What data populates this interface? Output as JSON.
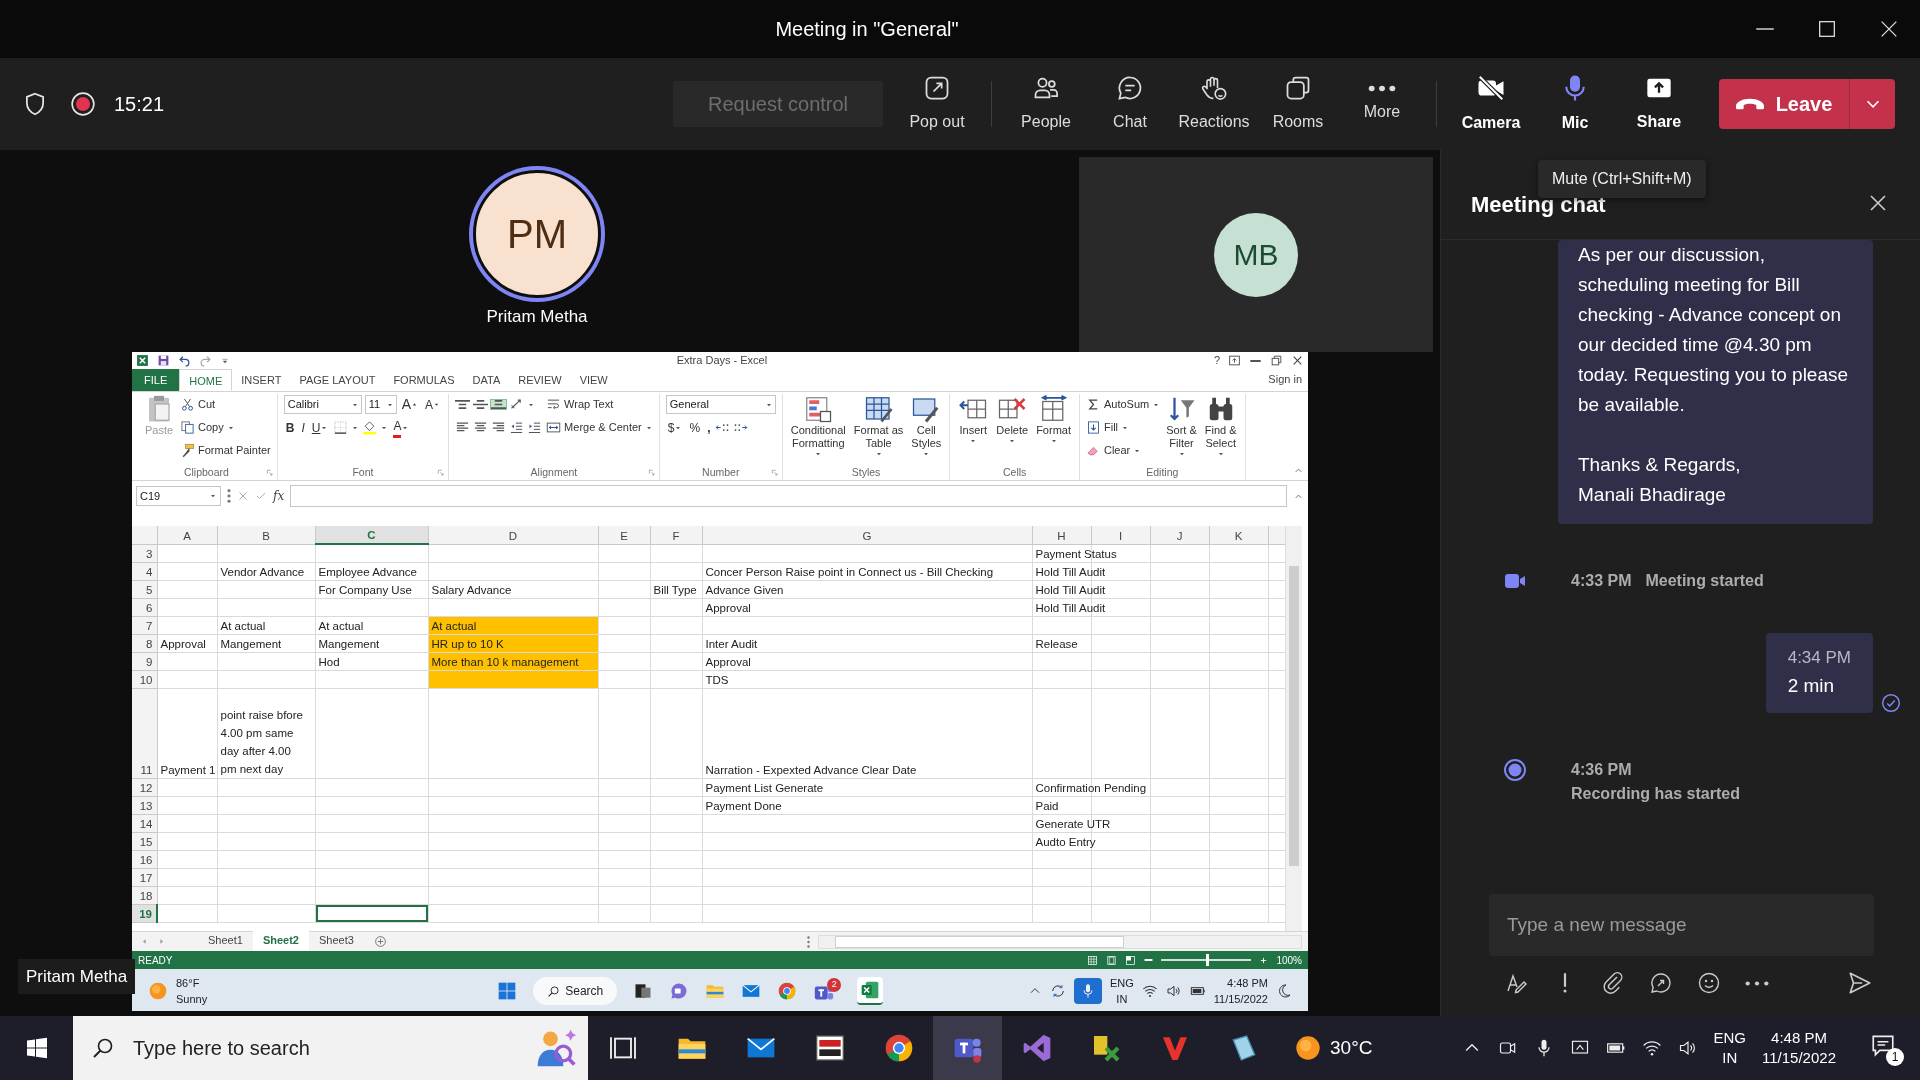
{
  "window": {
    "title": "Meeting in \"General\""
  },
  "toolbar": {
    "recording": true,
    "timer": "15:21",
    "request_control": {
      "label": "Request control",
      "disabled": true
    },
    "actions": [
      {
        "kind": "popout",
        "label": "Pop out"
      },
      {
        "kind": "people",
        "label": "People"
      },
      {
        "kind": "chat",
        "label": "Chat"
      },
      {
        "kind": "reactions",
        "label": "Reactions"
      },
      {
        "kind": "rooms",
        "label": "Rooms"
      },
      {
        "kind": "more",
        "label": "More"
      }
    ],
    "devices": [
      {
        "kind": "camera",
        "label": "Camera",
        "on": false
      },
      {
        "kind": "mic",
        "label": "Mic",
        "on": true
      }
    ],
    "share": "Share",
    "leave": "Leave"
  },
  "tooltip": "Mute (Ctrl+Shift+M)",
  "main_participant": {
    "initials": "PM",
    "name": "Pritam Metha",
    "speaking": true
  },
  "tile": {
    "initials": "MB"
  },
  "presenter_label": "Pritam Metha",
  "excel": {
    "title": "Extra Days - Excel",
    "help": "?",
    "tabs": [
      {
        "kind": "file",
        "label": "FILE",
        "selected": false
      },
      {
        "kind": "tab",
        "label": "HOME",
        "selected": true
      },
      {
        "kind": "tab",
        "label": "INSERT",
        "selected": false
      },
      {
        "kind": "tab",
        "label": "PAGE LAYOUT",
        "selected": false
      },
      {
        "kind": "tab",
        "label": "FORMULAS",
        "selected": false
      },
      {
        "kind": "tab",
        "label": "DATA",
        "selected": false
      },
      {
        "kind": "tab",
        "label": "REVIEW",
        "selected": false
      },
      {
        "kind": "tab",
        "label": "VIEW",
        "selected": false
      }
    ],
    "sign_in": "Sign in",
    "ribbon": [
      {
        "label": "Clipboard",
        "launcher": true,
        "columns": [
          [
            [
              {
                "kind": "paste",
                "label": "Paste",
                "disabled": true
              }
            ]
          ],
          [
            [
              {
                "kind": "cut",
                "label": "Cut"
              }
            ],
            [
              {
                "kind": "copy",
                "label": "Copy",
                "dropdown": true
              }
            ],
            [
              {
                "kind": "painter",
                "label": "Format Painter"
              }
            ]
          ]
        ]
      },
      {
        "label": "Font",
        "launcher": true,
        "columns": [
          [
            [
              {
                "kind": "font",
                "value": "Calibri"
              },
              {
                "kind": "size",
                "value": "11"
              },
              {
                "kind": "grow",
                "label": "A"
              },
              {
                "kind": "shrink",
                "label": "A"
              }
            ],
            [
              {
                "kind": "bold",
                "label": "B"
              },
              {
                "kind": "italic",
                "label": "I"
              },
              {
                "kind": "underline",
                "label": "U",
                "dropdown": true
              },
              {
                "kind": "borders",
                "dropdown": true
              },
              {
                "kind": "fillcolor",
                "dropdown": true
              },
              {
                "kind": "fontcolor",
                "label": "A",
                "dropdown": true
              }
            ]
          ]
        ]
      },
      {
        "label": "Alignment",
        "launcher": true,
        "columns": [
          [
            [
              {
                "kind": "top",
                "on": false
              },
              {
                "kind": "middle",
                "on": false
              },
              {
                "kind": "bottom",
                "on": true
              },
              {
                "kind": "orient",
                "dropdown": true
              }
            ],
            [
              {
                "kind": "left"
              },
              {
                "kind": "center"
              },
              {
                "kind": "right"
              },
              {
                "kind": "outdent"
              },
              {
                "kind": "indent"
              }
            ]
          ],
          [
            [
              {
                "kind": "wrap",
                "label": "Wrap Text"
              }
            ],
            [
              {
                "kind": "merge",
                "label": "Merge & Center",
                "dropdown": true
              }
            ]
          ]
        ]
      },
      {
        "label": "Number",
        "launcher": true,
        "columns": [
          [
            [
              {
                "kind": "numfmt",
                "value": "General"
              }
            ],
            [
              {
                "kind": "currency",
                "label": "$",
                "dropdown": true
              },
              {
                "kind": "percent",
                "label": "%"
              },
              {
                "kind": "comma",
                "label": ","
              },
              {
                "kind": "incdec"
              },
              {
                "kind": "decdec"
              }
            ]
          ]
        ]
      },
      {
        "label": "Styles",
        "launcher": false,
        "columns": [
          [
            [
              {
                "kind": "conditional",
                "label": "Conditional\nFormatting",
                "dropdown": true
              }
            ]
          ],
          [
            [
              {
                "kind": "astable",
                "label": "Format as\nTable",
                "dropdown": true
              }
            ]
          ],
          [
            [
              {
                "kind": "cellstyles",
                "label": "Cell\nStyles",
                "dropdown": true
              }
            ]
          ]
        ]
      },
      {
        "label": "Cells",
        "launcher": false,
        "columns": [
          [
            [
              {
                "kind": "insert",
                "label": "Insert",
                "dropdown": true
              }
            ]
          ],
          [
            [
              {
                "kind": "delete",
                "label": "Delete",
                "dropdown": true
              }
            ]
          ],
          [
            [
              {
                "kind": "format",
                "label": "Format",
                "dropdown": true
              }
            ]
          ]
        ]
      },
      {
        "label": "Editing",
        "launcher": false,
        "columns": [
          [
            [
              {
                "kind": "autosum",
                "label": "AutoSum",
                "dropdown": true
              }
            ],
            [
              {
                "kind": "filldown",
                "label": "Fill",
                "dropdown": true
              }
            ],
            [
              {
                "kind": "clear",
                "label": "Clear",
                "dropdown": true
              }
            ]
          ],
          [
            [
              {
                "kind": "sort",
                "label": "Sort &\nFilter",
                "dropdown": true
              }
            ]
          ],
          [
            [
              {
                "kind": "find",
                "label": "Find &\nSelect",
                "dropdown": true
              }
            ]
          ]
        ]
      }
    ],
    "name_box": "C19",
    "formula_label": "fx",
    "columns": [
      {
        "label": "A",
        "selected": false
      },
      {
        "label": "B",
        "selected": false
      },
      {
        "label": "C",
        "selected": true
      },
      {
        "label": "D",
        "selected": false
      },
      {
        "label": "E",
        "selected": false
      },
      {
        "label": "F",
        "selected": false
      },
      {
        "label": "G",
        "selected": false
      },
      {
        "label": "H",
        "selected": false
      },
      {
        "label": "I",
        "selected": false
      },
      {
        "label": "J",
        "selected": false
      },
      {
        "label": "K",
        "selected": false
      }
    ],
    "rows": [
      {
        "number": "3",
        "selected": false,
        "cells": {
          "H": "Payment Status"
        }
      },
      {
        "number": "4",
        "selected": false,
        "cells": {
          "B": "Vendor Advance",
          "C": "Employee Advance",
          "G": "Concer Person Raise point in Connect us - Bill Checking",
          "H": "Hold Till Audit"
        }
      },
      {
        "number": "5",
        "selected": false,
        "cells": {
          "C": "For Company Use",
          "D": "Salary Advance",
          "F": "Bill Type",
          "G": "Advance Given",
          "H": "Hold Till Audit"
        }
      },
      {
        "number": "6",
        "selected": false,
        "cells": {
          "G": "Approval",
          "H": "Hold Till Audit"
        }
      },
      {
        "number": "7",
        "selected": false,
        "cells": {
          "B": "At actual",
          "C": "At actual",
          "D": "At actual"
        },
        "filled": {
          "D": true
        }
      },
      {
        "number": "8",
        "selected": false,
        "cells": {
          "A": "Approval",
          "B": "Mangement",
          "C": "Mangement",
          "D": "HR up to 10 K",
          "G": "Inter Audit",
          "H": "Release"
        },
        "filled": {
          "D": true
        }
      },
      {
        "number": "9",
        "selected": false,
        "cells": {
          "C": "Hod",
          "D": "More than 10 k management",
          "G": "Approval"
        },
        "filled": {
          "D": true
        }
      },
      {
        "number": "10",
        "selected": false,
        "cells": {
          "G": "TDS"
        },
        "filled": {
          "D": true
        }
      },
      {
        "number": "11",
        "selected": false,
        "tall": true,
        "cells": {
          "A": "Payment 1",
          "B": "point raise bfore\n4.00 pm same\nday after 4.00\npm next day",
          "G": "Narration - Expexted Advance Clear Date"
        }
      },
      {
        "number": "12",
        "selected": false,
        "cells": {
          "G": "Payment List Generate",
          "H": "Confirmation Pending"
        }
      },
      {
        "number": "13",
        "selected": false,
        "cells": {
          "G": "Payment Done",
          "H": "Paid"
        }
      },
      {
        "number": "14",
        "selected": false,
        "cells": {
          "H": "Generate UTR"
        }
      },
      {
        "number": "15",
        "selected": false,
        "cells": {
          "H": "Audto Entry"
        }
      },
      {
        "number": "16",
        "selected": false,
        "cells": {}
      },
      {
        "number": "17",
        "selected": false,
        "cells": {}
      },
      {
        "number": "18",
        "selected": false,
        "cells": {}
      },
      {
        "number": "19",
        "selected": true,
        "cells": {}
      }
    ],
    "sheets": [
      {
        "label": "Sheet1",
        "selected": false
      },
      {
        "label": "Sheet2",
        "selected": true
      },
      {
        "label": "Sheet3",
        "selected": false
      }
    ],
    "status": "READY",
    "zoom": {
      "label": "100%",
      "level": 0.5
    },
    "taskbar": {
      "temperature": "86°F",
      "condition": "Sunny",
      "search": "Search",
      "teams_badge": "2",
      "lang": "ENG",
      "region": "IN",
      "time": "4:48 PM",
      "date": "11/15/2022"
    }
  },
  "chat": {
    "title": "Meeting chat",
    "messages": [
      {
        "kind": "message",
        "text": "As per our discussion, scheduling meeting for Bill checking - Advance concept on our decided time @4.30 pm today. Requesting you to please be available.\n\nThanks & Regards,\nManali Bhadirage",
        "seen": false
      },
      {
        "kind": "meeting",
        "time": "4:33 PM",
        "text": "Meeting started"
      },
      {
        "kind": "message",
        "time": "4:34 PM",
        "text": "2 min",
        "seen": true
      },
      {
        "kind": "recording",
        "time": "4:36 PM",
        "text": "Recording has started"
      }
    ],
    "placeholder": "Type a new message"
  },
  "taskbar": {
    "search_placeholder": "Type here to search",
    "temperature": "30°C",
    "lang": "ENG",
    "region": "IN",
    "time": "4:48 PM",
    "date": "11/15/2022",
    "notifications": "1"
  }
}
